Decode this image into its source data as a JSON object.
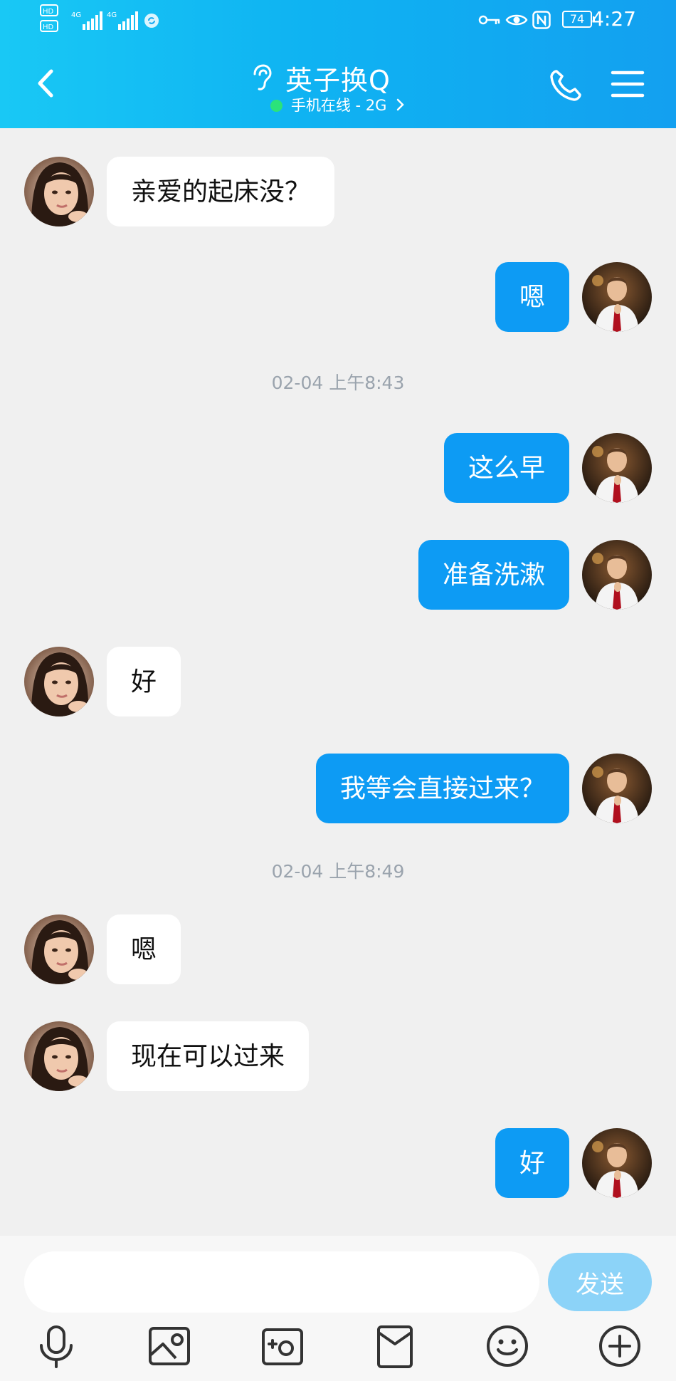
{
  "status_bar": {
    "network_left": "HD",
    "signal_1": "4G",
    "signal_2": "4G",
    "battery": "74",
    "time": "4:27"
  },
  "header": {
    "title": "英子换Q",
    "status": "手机在线 - 2G",
    "colors": {
      "header": "#13aaf2",
      "online_dot": "#2be37a"
    },
    "icons": [
      "chevron-left-icon",
      "ear-icon",
      "phone-icon",
      "menu-icon"
    ]
  },
  "messages": [
    {
      "side": "in",
      "text": "亲爱的起床没？"
    },
    {
      "side": "out",
      "text": "嗯"
    },
    {
      "timestamp": "02-04 上午8:43"
    },
    {
      "side": "out",
      "text": "这么早"
    },
    {
      "side": "out",
      "text": "准备洗漱"
    },
    {
      "side": "in",
      "text": "好"
    },
    {
      "side": "out",
      "text": "我等会直接过来？"
    },
    {
      "timestamp": "02-04 上午8:49"
    },
    {
      "side": "in",
      "text": "嗯"
    },
    {
      "side": "in",
      "text": "现在可以过来"
    },
    {
      "side": "out",
      "text": "好"
    }
  ],
  "composer": {
    "input_value": "",
    "send_label": "发送",
    "colors": {
      "outgoing_bubble": "#0d9bf4",
      "send_button": "#8cd3f8"
    }
  },
  "toolbar": {
    "icons": [
      "microphone-icon",
      "image-icon",
      "camera-icon",
      "red-packet-icon",
      "emoji-icon",
      "plus-icon"
    ]
  }
}
